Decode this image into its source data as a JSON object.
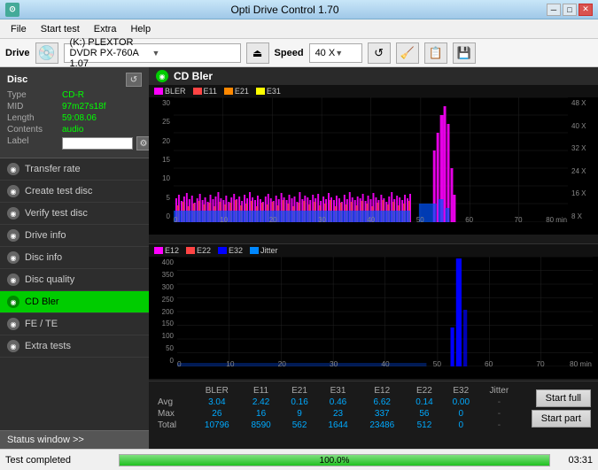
{
  "titlebar": {
    "title": "Opti Drive Control 1.70",
    "min_label": "─",
    "max_label": "□",
    "close_label": "✕"
  },
  "menubar": {
    "items": [
      "File",
      "Start test",
      "Extra",
      "Help"
    ]
  },
  "drivebar": {
    "drive_label": "Drive",
    "drive_value": "(K:)  PLEXTOR DVDR  PX-760A 1.07",
    "speed_label": "Speed",
    "speed_value": "40 X"
  },
  "sidebar": {
    "disc_title": "Disc",
    "disc_type_key": "Type",
    "disc_type_val": "CD-R",
    "disc_mid_key": "MID",
    "disc_mid_val": "97m27s18f",
    "disc_length_key": "Length",
    "disc_length_val": "59:08.06",
    "disc_contents_key": "Contents",
    "disc_contents_val": "audio",
    "disc_label_key": "Label",
    "nav_items": [
      {
        "id": "transfer-rate",
        "label": "Transfer rate",
        "active": false
      },
      {
        "id": "create-test-disc",
        "label": "Create test disc",
        "active": false
      },
      {
        "id": "verify-test-disc",
        "label": "Verify test disc",
        "active": false
      },
      {
        "id": "drive-info",
        "label": "Drive info",
        "active": false
      },
      {
        "id": "disc-info",
        "label": "Disc info",
        "active": false
      },
      {
        "id": "disc-quality",
        "label": "Disc quality",
        "active": false
      },
      {
        "id": "cd-bler",
        "label": "CD Bler",
        "active": true
      },
      {
        "id": "fe-te",
        "label": "FE / TE",
        "active": false
      },
      {
        "id": "extra-tests",
        "label": "Extra tests",
        "active": false
      }
    ],
    "status_window_label": "Status window >>"
  },
  "chart1": {
    "title": "CD Bler",
    "legend": [
      {
        "key": "BLER",
        "color": "#ff00ff"
      },
      {
        "key": "E11",
        "color": "#ff4444"
      },
      {
        "key": "E21",
        "color": "#ff8800"
      },
      {
        "key": "E31",
        "color": "#ffff00"
      }
    ],
    "y_labels": [
      "0",
      "5",
      "10",
      "15",
      "20",
      "25",
      "30"
    ],
    "y_labels_right": [
      "8 X",
      "16 X",
      "24 X",
      "32 X",
      "40 X",
      "48 X"
    ],
    "x_labels": [
      "0",
      "10",
      "20",
      "30",
      "40",
      "50",
      "60",
      "70",
      "80 min"
    ]
  },
  "chart2": {
    "legend": [
      {
        "key": "E12",
        "color": "#ff00ff"
      },
      {
        "key": "E22",
        "color": "#ff4444"
      },
      {
        "key": "E32",
        "color": "#0000ff"
      },
      {
        "key": "Jitter",
        "color": "#0088ff"
      }
    ],
    "y_labels": [
      "0",
      "50",
      "100",
      "150",
      "200",
      "250",
      "300",
      "350",
      "400"
    ],
    "x_labels": [
      "0",
      "10",
      "20",
      "30",
      "40",
      "50",
      "60",
      "70",
      "80 min"
    ]
  },
  "table": {
    "headers": [
      "",
      "BLER",
      "E11",
      "E21",
      "E31",
      "E12",
      "E22",
      "E32",
      "Jitter",
      ""
    ],
    "rows": [
      {
        "label": "Avg",
        "bler": "3.04",
        "e11": "2.42",
        "e21": "0.16",
        "e31": "0.46",
        "e12": "6.62",
        "e22": "0.14",
        "e32": "0.00",
        "jitter": "-"
      },
      {
        "label": "Max",
        "bler": "26",
        "e11": "16",
        "e21": "9",
        "e31": "23",
        "e12": "337",
        "e22": "56",
        "e32": "0",
        "jitter": "-"
      },
      {
        "label": "Total",
        "bler": "10796",
        "e11": "8590",
        "e21": "562",
        "e31": "1644",
        "e12": "23486",
        "e22": "512",
        "e32": "0",
        "jitter": "-"
      }
    ]
  },
  "buttons": {
    "start_full": "Start full",
    "start_part": "Start part"
  },
  "statusbar": {
    "status_text": "Test completed",
    "progress": 100.0,
    "progress_label": "100.0%",
    "time": "03:31"
  }
}
